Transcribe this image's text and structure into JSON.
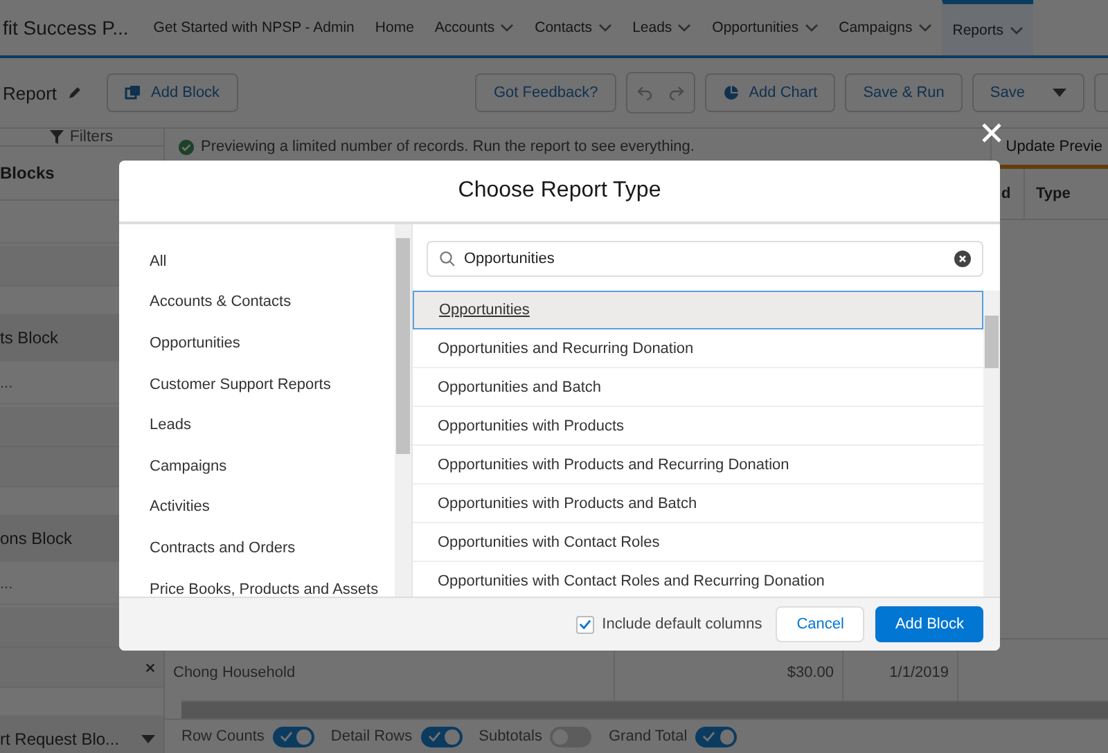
{
  "app_name": "fit Success P...",
  "nav_tabs": [
    {
      "label": "Get Started with NPSP - Admin",
      "menu": false,
      "selected": false
    },
    {
      "label": "Home",
      "menu": false,
      "selected": false
    },
    {
      "label": "Accounts",
      "menu": true,
      "selected": false
    },
    {
      "label": "Contacts",
      "menu": true,
      "selected": false
    },
    {
      "label": "Leads",
      "menu": true,
      "selected": false
    },
    {
      "label": "Opportunities",
      "menu": true,
      "selected": false
    },
    {
      "label": "Campaigns",
      "menu": true,
      "selected": false
    },
    {
      "label": "Reports",
      "menu": true,
      "selected": true
    }
  ],
  "toolbar": {
    "title": "Report",
    "add_block": "Add Block",
    "feedback": "Got Feedback?",
    "add_chart": "Add Chart",
    "save_run": "Save & Run",
    "save": "Save"
  },
  "side_panel": {
    "tab": "Filters",
    "rows": [
      {
        "kind": "header",
        "text": "Blocks"
      },
      {
        "kind": "search",
        "text": ""
      },
      {
        "kind": "item",
        "text": ""
      },
      {
        "kind": "gap",
        "text": ""
      },
      {
        "kind": "block",
        "text": "ts Block"
      },
      {
        "kind": "search",
        "text": "..."
      },
      {
        "kind": "item",
        "text": ""
      },
      {
        "kind": "item",
        "text": ""
      },
      {
        "kind": "gap",
        "text": ""
      },
      {
        "kind": "block",
        "text": "ons Block"
      },
      {
        "kind": "search",
        "text": "..."
      },
      {
        "kind": "item",
        "text": ""
      },
      {
        "kind": "item",
        "text": ""
      },
      {
        "kind": "gap",
        "text": ""
      },
      {
        "kind": "block",
        "text": "rt Request Blo..."
      }
    ]
  },
  "banner": {
    "message": "Previewing a limited number of records. Run the report to see everything.",
    "update": "Update Previe"
  },
  "table": {
    "columns": [
      "d",
      "Type"
    ],
    "rows": [
      [
        "Chong Household",
        "$30.00",
        "1/1/2019"
      ]
    ]
  },
  "footer_toggles": [
    {
      "label": "Row Counts",
      "on": true
    },
    {
      "label": "Detail Rows",
      "on": true
    },
    {
      "label": "Subtotals",
      "on": false
    },
    {
      "label": "Grand Total",
      "on": true
    }
  ],
  "dialog": {
    "title": "Choose Report Type",
    "categories": [
      {
        "label": "All",
        "selected": false
      },
      {
        "label": "Accounts & Contacts",
        "selected": false
      },
      {
        "label": "Opportunities",
        "selected": false
      },
      {
        "label": "Customer Support Reports",
        "selected": false
      },
      {
        "label": "Leads",
        "selected": false
      },
      {
        "label": "Campaigns",
        "selected": false
      },
      {
        "label": "Activities",
        "selected": false
      },
      {
        "label": "Contracts and Orders",
        "selected": false
      },
      {
        "label": "Price Books, Products and Assets",
        "selected": false
      }
    ],
    "search": {
      "value": "Opportunities"
    },
    "results": [
      {
        "label": "Opportunities",
        "selected": true
      },
      {
        "label": "Opportunities and Recurring Donation",
        "selected": false
      },
      {
        "label": "Opportunities and Batch",
        "selected": false
      },
      {
        "label": "Opportunities with Products",
        "selected": false
      },
      {
        "label": "Opportunities with Products and Recurring Donation",
        "selected": false
      },
      {
        "label": "Opportunities with Products and Batch",
        "selected": false
      },
      {
        "label": "Opportunities with Contact Roles",
        "selected": false
      },
      {
        "label": "Opportunities with Contact Roles and Recurring Donation",
        "selected": false
      }
    ],
    "include_default_columns": {
      "label": "Include default columns",
      "checked": true
    },
    "cancel": "Cancel",
    "confirm": "Add Block"
  }
}
